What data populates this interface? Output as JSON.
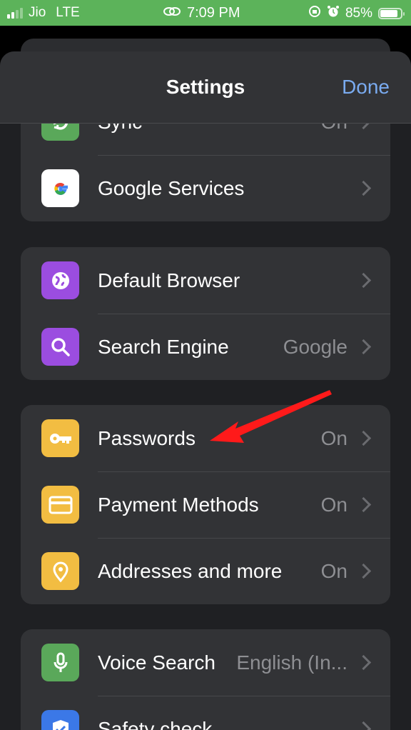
{
  "status_bar": {
    "carrier": "Jio",
    "network": "LTE",
    "time": "7:09 PM",
    "battery": "85%",
    "battery_level": 0.85
  },
  "nav": {
    "title": "Settings",
    "done_label": "Done"
  },
  "groups": [
    {
      "items": [
        {
          "label": "Sync",
          "value": "On",
          "icon": "sync-icon",
          "color": "#5aa85a"
        },
        {
          "label": "Google Services",
          "value": "",
          "icon": "google-logo-icon",
          "color": "#ffffff"
        }
      ]
    },
    {
      "items": [
        {
          "label": "Default Browser",
          "value": "",
          "icon": "globe-icon",
          "color": "#9b4de0"
        },
        {
          "label": "Search Engine",
          "value": "Google",
          "icon": "search-icon",
          "color": "#9b4de0"
        }
      ]
    },
    {
      "items": [
        {
          "label": "Passwords",
          "value": "On",
          "icon": "key-icon",
          "color": "#f2bd42"
        },
        {
          "label": "Payment Methods",
          "value": "On",
          "icon": "credit-card-icon",
          "color": "#f2bd42"
        },
        {
          "label": "Addresses and more",
          "value": "On",
          "icon": "location-pin-icon",
          "color": "#f2bd42"
        }
      ]
    },
    {
      "items": [
        {
          "label": "Voice Search",
          "value": "English (In...",
          "icon": "microphone-icon",
          "color": "#5aa85a"
        },
        {
          "label": "Safety check",
          "value": "",
          "icon": "shield-check-icon",
          "color": "#3b78e7"
        }
      ]
    }
  ],
  "annotation": {
    "color": "#ff1a1a",
    "target": "Passwords"
  }
}
